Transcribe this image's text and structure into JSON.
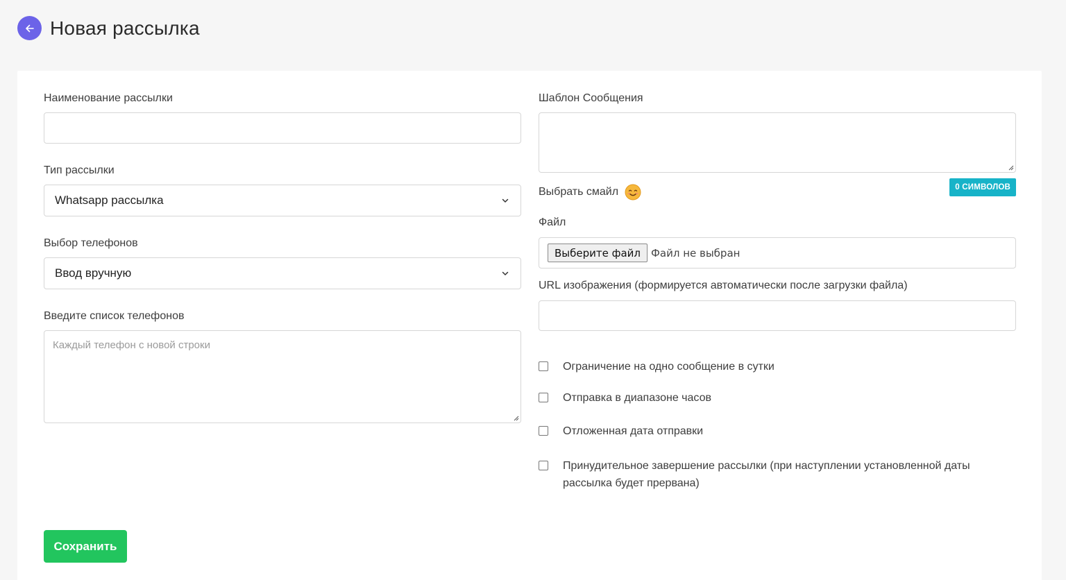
{
  "header": {
    "title": "Новая рассылка",
    "back_icon": "arrow-left-icon",
    "accent_color": "#6c63e8"
  },
  "form": {
    "name": {
      "label": "Наименование рассылки",
      "value": ""
    },
    "type": {
      "label": "Тип рассылки",
      "selected": "Whatsapp рассылка"
    },
    "phones_mode": {
      "label": "Выбор телефонов",
      "selected": "Ввод вручную"
    },
    "phones_list": {
      "label": "Введите список телефонов",
      "placeholder": "Каждый телефон с новой строки",
      "value": ""
    },
    "template": {
      "label": "Шаблон Сообщения",
      "value": "",
      "counter": "0 СИМВОЛОВ"
    },
    "emoji": {
      "label": "Выбрать смайл",
      "icon": "smiling-face-emoji-icon"
    },
    "file": {
      "label": "Файл",
      "button": "Выберите файл",
      "status": "Файл не выбран"
    },
    "image_url": {
      "label": "URL изображения (формируется автоматически после загрузки файла)",
      "value": ""
    },
    "options": [
      {
        "label": "Ограничение на одно сообщение в сутки",
        "checked": false
      },
      {
        "label": "Отправка в диапазоне часов",
        "checked": false
      },
      {
        "label": "Отложенная дата отправки",
        "checked": false
      },
      {
        "label": "Принудительное завершение рассылки (при наступлении установленной даты рассылка будет прервана)",
        "checked": false
      }
    ],
    "save_label": "Сохранить"
  },
  "colors": {
    "save_button": "#22c55e",
    "counter_badge": "#17b3c8",
    "background": "#f6f6f6"
  }
}
